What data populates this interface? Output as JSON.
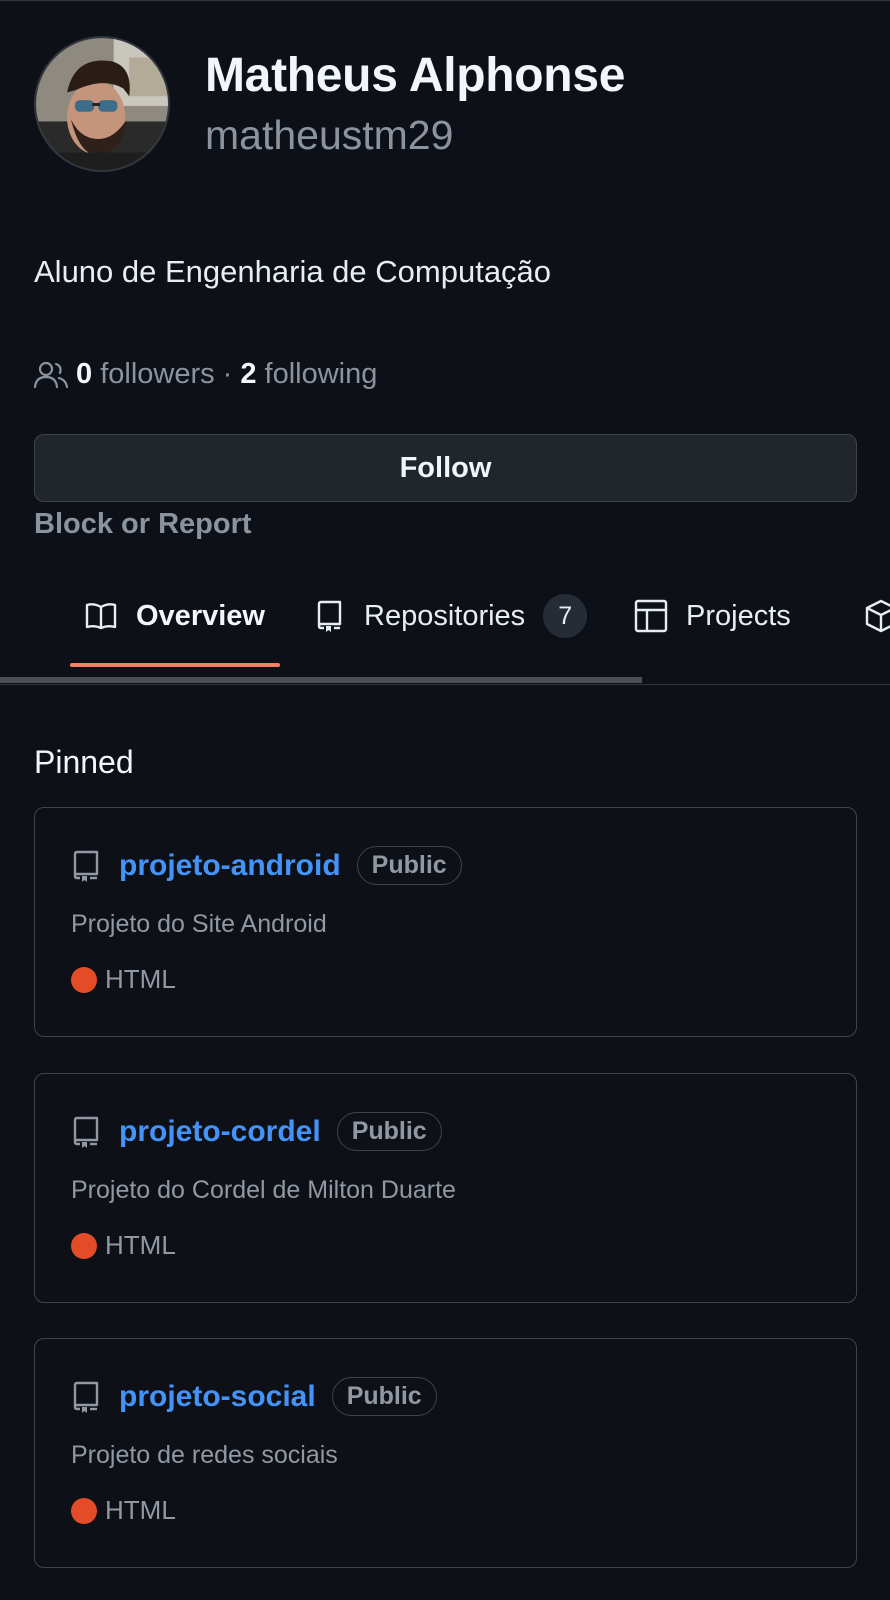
{
  "profile": {
    "name": "Matheus Alphonse",
    "login": "matheustm29",
    "bio": "Aluno de Engenharia de Computação",
    "followers_count": "0",
    "followers_label": "followers",
    "separator": "·",
    "following_count": "2",
    "following_label": "following"
  },
  "actions": {
    "follow_label": "Follow",
    "block_label": "Block or Report"
  },
  "tabs": [
    {
      "label": "Overview",
      "icon": "book-icon",
      "active": true
    },
    {
      "label": "Repositories",
      "icon": "repo-icon",
      "counter": "7"
    },
    {
      "label": "Projects",
      "icon": "table-icon"
    },
    {
      "label": "",
      "icon": "package-icon"
    }
  ],
  "pinned": {
    "title": "Pinned",
    "items": [
      {
        "name": "projeto-android",
        "visibility": "Public",
        "description": "Projeto do Site Android",
        "language": "HTML",
        "language_color": "#e34c26"
      },
      {
        "name": "projeto-cordel",
        "visibility": "Public",
        "description": "Projeto do Cordel de Milton Duarte",
        "language": "HTML",
        "language_color": "#e34c26"
      },
      {
        "name": "projeto-social",
        "visibility": "Public",
        "description": "Projeto de redes sociais",
        "language": "HTML",
        "language_color": "#e34c26"
      }
    ]
  },
  "colors": {
    "background": "#0d1117",
    "link": "#4493f8",
    "active_tab_underline": "#f78166"
  }
}
